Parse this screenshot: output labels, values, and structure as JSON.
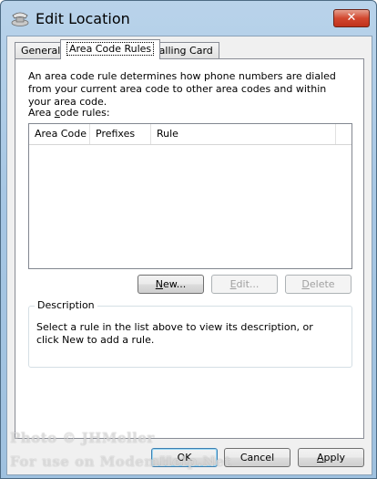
{
  "window": {
    "title": "Edit Location",
    "close_label": "✕"
  },
  "tabs": [
    {
      "label": "General"
    },
    {
      "label": "Area Code Rules",
      "active": true
    },
    {
      "label": "Calling Card"
    }
  ],
  "intro_text": "An area code rule determines how phone numbers are dialed from your current area code to other area codes and within your area code.",
  "rules_label": {
    "prefix": "Area ",
    "mnemonic": "c",
    "suffix": "ode rules:"
  },
  "listview": {
    "columns": [
      "Area Code",
      "Prefixes",
      "Rule"
    ],
    "rows": []
  },
  "rule_buttons": {
    "new": {
      "mnemonic": "N",
      "rest": "ew..."
    },
    "edit": {
      "mnemonic": "E",
      "rest": "dit..."
    },
    "delete": {
      "mnemonic": "D",
      "rest": "elete"
    }
  },
  "description": {
    "title": "Description",
    "text": "Select a rule in the list above to view its description, or click New to add a rule."
  },
  "dialog_buttons": {
    "ok": "OK",
    "cancel": "Cancel",
    "apply_mnemonic": "A",
    "apply_rest": "pply"
  },
  "watermark": {
    "line1": "Photo © JHMeller",
    "line2": "For use on ModemHelp.Net"
  },
  "colors": {
    "title_bar": "#a7c7e4",
    "close_button": "#c8402a",
    "client_bg": "#f0f0f0"
  }
}
